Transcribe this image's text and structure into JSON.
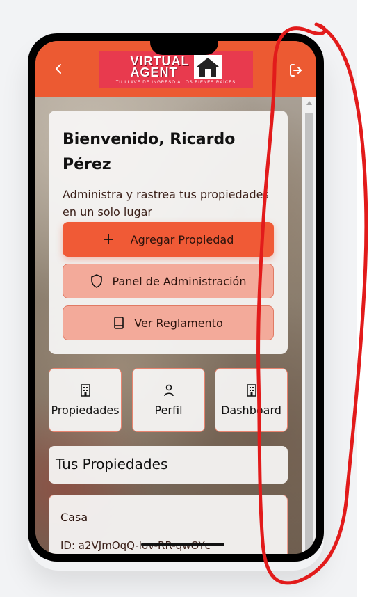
{
  "header": {
    "back_icon": "chevron-left-icon",
    "logout_icon": "logout-icon",
    "logo": {
      "line1": "VIRTUAL",
      "line2": "AGENT",
      "tagline": "TU LLAVE DE INGRESO A LOS BIENES RAÍCES",
      "bg_color": "#e83a4e"
    },
    "bg_color": "#ec5a32"
  },
  "welcome": {
    "title": "Bienvenido, Ricardo Pérez",
    "subtitle": "Administra y rastrea tus propiedades en un solo lugar",
    "buttons": [
      {
        "label": "Agregar Propiedad",
        "icon": "plus-icon",
        "color": "#f05a36"
      },
      {
        "label": "Panel de Administración",
        "icon": "shield-icon",
        "color": "#f3aa9a"
      },
      {
        "label": "Ver Reglamento",
        "icon": "book-icon",
        "color": "#f3aa9a"
      }
    ]
  },
  "quick_links": [
    {
      "label": "Propiedades",
      "icon": "building-icon"
    },
    {
      "label": "Perfil",
      "icon": "user-icon"
    },
    {
      "label": "Dashboard",
      "icon": "building-icon"
    }
  ],
  "properties": {
    "heading": "Tus Propiedades",
    "items": [
      {
        "name": "Casa",
        "id_text": "ID: a2VJmOqQ-lov-RR-qwOYc"
      }
    ]
  },
  "colors": {
    "accent": "#ec5a32",
    "annotation": "#e21b1b"
  }
}
